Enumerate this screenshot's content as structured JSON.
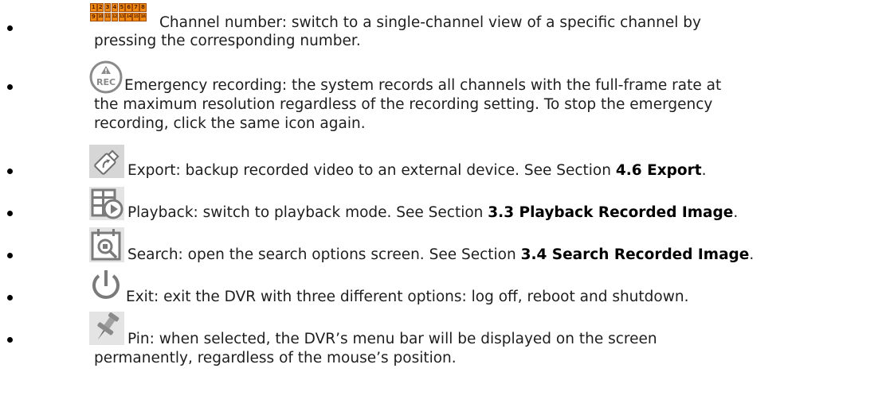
{
  "channel_numbers": [
    "1",
    "2",
    "3",
    "4",
    "5",
    "6",
    "7",
    "8",
    "9",
    "10",
    "11",
    "12",
    "13",
    "14",
    "15",
    "16"
  ],
  "items": [
    {
      "icon": "channel-number-icon",
      "line1": "Channel number: switch to a single-channel view of a specific channel by",
      "line2": "pressing the corresponding number."
    },
    {
      "icon": "emergency-record-icon",
      "icon_text": "REC",
      "line1": "Emergency recording: the system records all channels with the full-frame rate at",
      "line2": "the maximum resolution regardless of the recording setting. To stop the emergency",
      "line3": "recording, click the same icon again."
    },
    {
      "icon": "export-usb-icon",
      "text": "Export: backup recorded video to an external device. See Section ",
      "ref": "4.6 Export",
      "after": "."
    },
    {
      "icon": "playback-icon",
      "text": "Playback: switch to playback mode. See Section ",
      "ref": "3.3 Playback Recorded Image",
      "after": "."
    },
    {
      "icon": "search-calendar-icon",
      "text": "Search: open the search options screen. See Section ",
      "ref": "3.4 Search Recorded Image",
      "after": "."
    },
    {
      "icon": "power-icon",
      "text": "Exit: exit the DVR with three different options: log off, reboot and shutdown."
    },
    {
      "icon": "pin-icon",
      "line1": "Pin: when selected, the DVR’s menu bar will be displayed on the screen",
      "line2": "permanently, regardless of the mouse’s position."
    }
  ],
  "colors": {
    "icon_gray": "#8a8a8a",
    "icon_orange": "#f08a12",
    "text": "#1e1e1e"
  }
}
